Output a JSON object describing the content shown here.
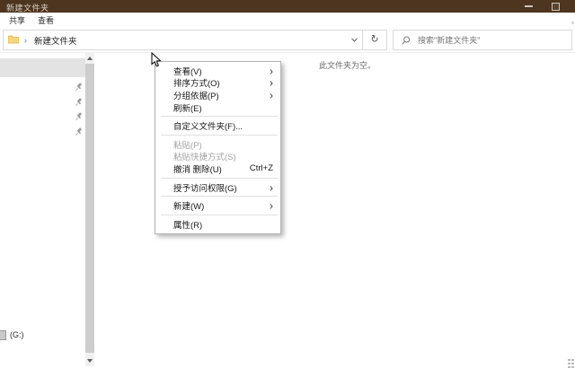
{
  "window": {
    "title": "新建文件夹"
  },
  "ribbon": {
    "tabs": {
      "share": "共享",
      "view": "查看"
    }
  },
  "toolbar": {
    "breadcrumb_path": "新建文件夹",
    "icons": {
      "breadcrumb_chevron": "›",
      "refresh": "↻"
    }
  },
  "search": {
    "placeholder": "搜索\"新建文件夹\""
  },
  "sidebar": {
    "drive_label": "(G:)",
    "pinned_item_count": 4
  },
  "content": {
    "empty_message": "此文件夹为空。"
  },
  "context_menu": {
    "items": [
      {
        "label": "查看(V)",
        "submenu": true
      },
      {
        "label": "排序方式(O)",
        "submenu": true
      },
      {
        "label": "分组依据(P)",
        "submenu": true
      },
      {
        "label": "刷新(E)",
        "separator_after": true
      },
      {
        "label": "自定义文件夹(F)...",
        "separator_after": true
      },
      {
        "label": "粘贴(P)",
        "disabled": true
      },
      {
        "label": "粘贴快捷方式(S)",
        "disabled": true
      },
      {
        "label": "撤消 删除(U)",
        "shortcut": "Ctrl+Z",
        "separator_after": true
      },
      {
        "label": "授予访问权限(G)",
        "submenu": true,
        "separator_after": true
      },
      {
        "label": "新建(W)",
        "submenu": true,
        "separator_after": true
      },
      {
        "label": "属性(R)"
      }
    ]
  },
  "icons": {
    "submenu_arrow": "›"
  },
  "colors": {
    "titlebar": "#4d351f",
    "menu_border": "#b3b3b3",
    "disabled_text": "#a3a3a3",
    "selection_band": "#e3e3e3",
    "scrollbar_thumb": "#cdcdcd",
    "folder_icon": "#f5d57c"
  }
}
